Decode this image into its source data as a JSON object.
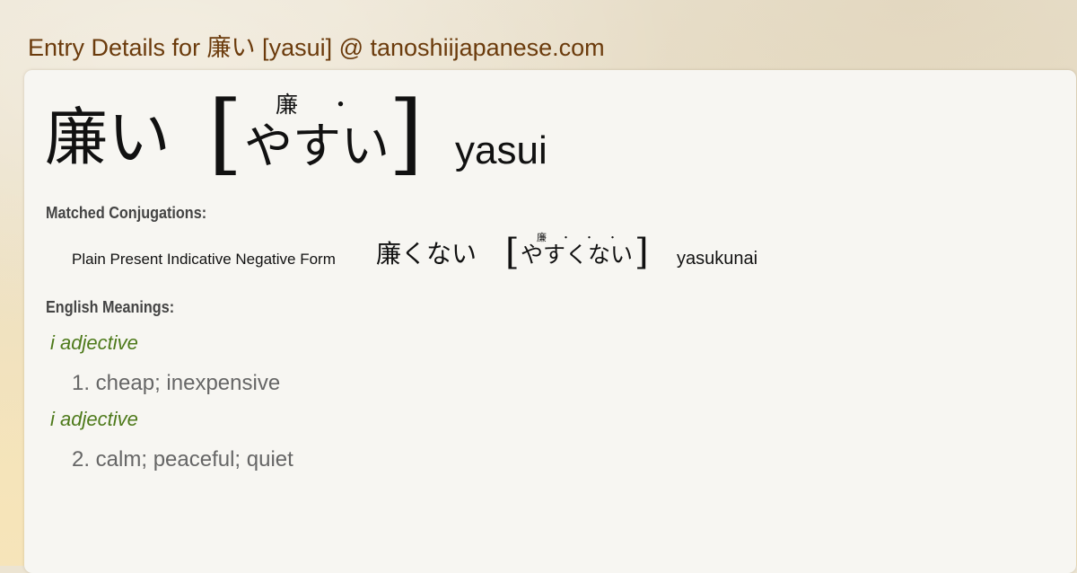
{
  "page": {
    "title": "Entry Details for 廉い [yasui] @ tanoshiijapanese.com"
  },
  "entry": {
    "word": "廉い",
    "bracket_open": "[",
    "bracket_close": "]",
    "reading": "やすい",
    "furigana": [
      "廉",
      "・"
    ],
    "romaji": "yasui"
  },
  "conjugations": {
    "heading": "Matched Conjugations:",
    "items": [
      {
        "form": "Plain Present Indicative Negative Form",
        "word": "廉くない",
        "reading": "やすくない",
        "furigana": [
          "廉",
          "・",
          "・",
          "・"
        ],
        "romaji": "yasukunai"
      }
    ]
  },
  "meanings": {
    "heading": "English Meanings:",
    "items": [
      {
        "pos": "i adjective",
        "gloss": "1. cheap; inexpensive"
      },
      {
        "pos": "i adjective",
        "gloss": "2. calm; peaceful; quiet"
      }
    ]
  },
  "colors": {
    "title": "#6b3b0c",
    "pos": "#4e7a1b",
    "gloss": "#666666",
    "card": "#f7f6f2"
  }
}
